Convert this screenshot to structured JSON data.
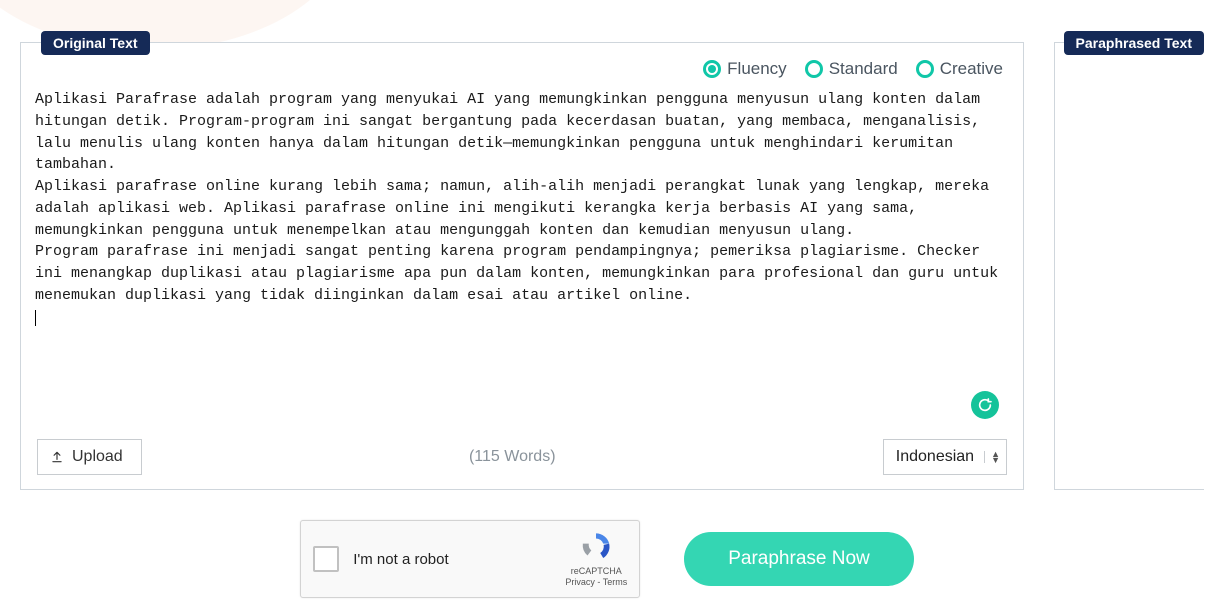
{
  "panels": {
    "original_label": "Original Text",
    "paraphrased_label": "Paraphrased Text"
  },
  "modes": {
    "fluency": "Fluency",
    "standard": "Standard",
    "creative": "Creative",
    "selected": "fluency"
  },
  "content": {
    "text": "Aplikasi Parafrase adalah program yang menyukai AI yang memungkinkan pengguna menyusun ulang konten dalam hitungan detik. Program-program ini sangat bergantung pada kecerdasan buatan, yang membaca, menganalisis, lalu menulis ulang konten hanya dalam hitungan detik—memungkinkan pengguna untuk menghindari kerumitan tambahan.\nAplikasi parafrase online kurang lebih sama; namun, alih-alih menjadi perangkat lunak yang lengkap, mereka adalah aplikasi web. Aplikasi parafrase online ini mengikuti kerangka kerja berbasis AI yang sama, memungkinkan pengguna untuk menempelkan atau mengunggah konten dan kemudian menyusun ulang.\nProgram parafrase ini menjadi sangat penting karena program pendampingnya; pemeriksa plagiarisme. Checker ini menangkap duplikasi atau plagiarisme apa pun dalam konten, memungkinkan para profesional dan guru untuk menemukan duplikasi yang tidak diinginkan dalam esai atau artikel online."
  },
  "footer": {
    "upload_label": "Upload",
    "word_count": "(115 Words)",
    "language": "Indonesian"
  },
  "recaptcha": {
    "label": "I'm not a robot",
    "brand": "reCAPTCHA",
    "privacy": "Privacy",
    "terms": "Terms"
  },
  "actions": {
    "paraphrase_now": "Paraphrase Now"
  }
}
